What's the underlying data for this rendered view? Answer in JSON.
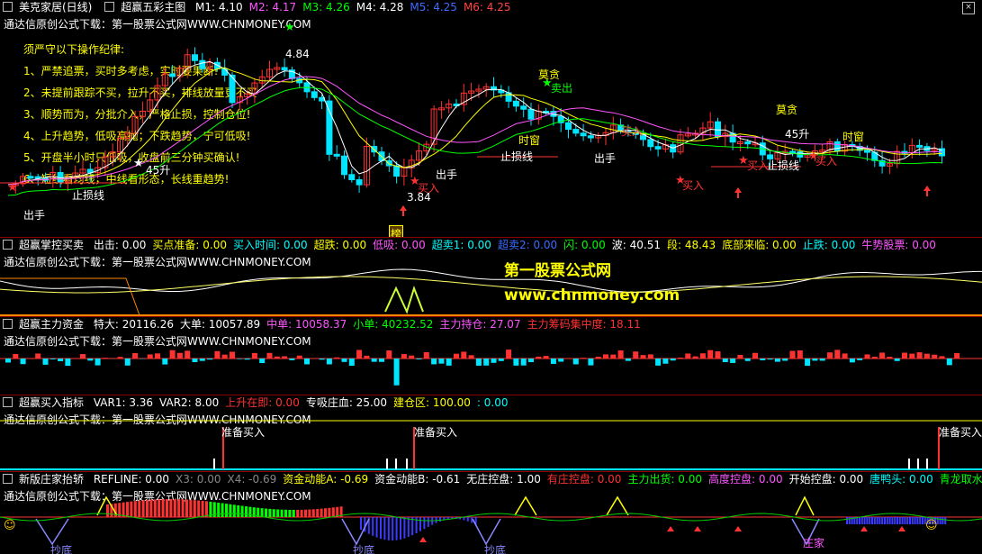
{
  "main": {
    "stock": "美克家居(日线)",
    "indicator": "超赢五彩主图",
    "ma": [
      {
        "label": "M1: 4.10",
        "color": "#ffffff"
      },
      {
        "label": "M2: 4.17",
        "color": "#ff55ff"
      },
      {
        "label": "M3: 4.26",
        "color": "#00ff00"
      },
      {
        "label": "M4: 4.28",
        "color": "#ffffff"
      },
      {
        "label": "M5: 4.25",
        "color": "#3b6bff"
      },
      {
        "label": "M6: 4.25",
        "color": "#ff4444"
      }
    ],
    "download": "通达信原创公式下载：第一股票公式网WWW.CHNMONEY.COM",
    "rules": [
      "须严守以下操作纪律:",
      "1、严禁追票，买时多考虑，实时要果断!",
      "2、未提前跟踪不买，拉升不买，排线放量更不买",
      "3、顺势而为，分批介入，严格止损，控制仓位!",
      "4、上升趋势，低吸高抛；下跌趋势，宁可低吸!",
      "5、开盘半小时只低吸，收盘前三分钟买确认!",
      "6、短线看均线，中线看形态，长线重趋势!"
    ],
    "labels": {
      "high_price": "4.84",
      "low_price": "3.84",
      "sell_out": "出手",
      "stop_loss": "止损线",
      "buy_in": "买入",
      "sell": "卖出",
      "greed": "莫贪",
      "timing": "时窗",
      "rise": "45升",
      "bang": "榜"
    },
    "colors": {
      "up": "#ff3232",
      "down": "#00e5ff",
      "grid": "#8b0000"
    }
  },
  "panel2": {
    "name": "超赢掌控买卖",
    "values": [
      {
        "label": "出击: 0.00",
        "color": "#ffffff"
      },
      {
        "label": "买点准备: 0.00",
        "color": "#ffff00"
      },
      {
        "label": "买入时间: 0.00",
        "color": "#00ffff"
      },
      {
        "label": "超跌: 0.00",
        "color": "#ffff00"
      },
      {
        "label": "低吸: 0.00",
        "color": "#ff55ff"
      },
      {
        "label": "超卖1: 0.00",
        "color": "#00ffff"
      },
      {
        "label": "超卖2: 0.00",
        "color": "#3b6bff"
      },
      {
        "label": "闪: 0.00",
        "color": "#00ff00"
      },
      {
        "label": "波: 40.51",
        "color": "#ffffff"
      },
      {
        "label": "段: 48.43",
        "color": "#ffff00"
      },
      {
        "label": "底部来临: 0.00",
        "color": "#ffff00"
      },
      {
        "label": "止跌: 0.00",
        "color": "#00ffff"
      },
      {
        "label": "牛势股票: 0.00",
        "color": "#ff55ff"
      }
    ],
    "download": "通达信原创公式下载：第一股票公式网WWW.CHNMONEY.COM",
    "watermark_title": "第一股票公式网",
    "watermark_url": "www.chnmoney.com"
  },
  "panel3": {
    "name": "超赢主力资金",
    "values": [
      {
        "label": "特大: 20116.26",
        "color": "#ffffff"
      },
      {
        "label": "大单: 10057.89",
        "color": "#ffffff"
      },
      {
        "label": "中单: 10058.37",
        "color": "#ff55ff"
      },
      {
        "label": "小单: 40232.52",
        "color": "#00ff00"
      },
      {
        "label": "主力持仓: 27.07",
        "color": "#ff55ff"
      },
      {
        "label": "主力筹码集中度: 18.11",
        "color": "#ff3232"
      }
    ],
    "download": "通达信原创公式下载：第一股票公式网WWW.CHNMONEY.COM"
  },
  "panel4": {
    "name": "超赢买入指标",
    "values": [
      {
        "label": "VAR1: 3.36",
        "color": "#ffffff"
      },
      {
        "label": "VAR2: 8.00",
        "color": "#ffffff"
      },
      {
        "label": "上升在即: 0.00",
        "color": "#ff3232"
      },
      {
        "label": "专吸庄血: 25.00",
        "color": "#ffffff"
      },
      {
        "label": "建仓区: 100.00",
        "color": "#ffff00"
      },
      {
        "label": ": 0.00",
        "color": "#00ffff"
      }
    ],
    "download": "通达信原创公式下载：第一股票公式网WWW.CHNMONEY.COM",
    "ready_buy": "准备买入"
  },
  "panel5": {
    "name": "新版庄家抬轿",
    "values": [
      {
        "label": "REFLINE: 0.00",
        "color": "#ffffff"
      },
      {
        "label": "X3: 0.00",
        "color": "#888888"
      },
      {
        "label": "X4: -0.69",
        "color": "#888888"
      },
      {
        "label": "资金动能A: -0.69",
        "color": "#ffff00"
      },
      {
        "label": "资金动能B: -0.61",
        "color": "#ffffff"
      },
      {
        "label": "无庄控盘: 1.00",
        "color": "#ffffff"
      },
      {
        "label": "有庄控盘: 0.00",
        "color": "#ff3232"
      },
      {
        "label": "主力出货: 0.00",
        "color": "#00ff00"
      },
      {
        "label": "高度控盘: 0.00",
        "color": "#ff55ff"
      },
      {
        "label": "开始控盘: 0.00",
        "color": "#ffffff"
      },
      {
        "label": "唐鸭头: 0.00",
        "color": "#00ffff"
      },
      {
        "label": "青龙取水: 0.00",
        "color": "#00ff00"
      },
      {
        "label": "绝",
        "color": "#ffffff"
      }
    ],
    "download": "通达信原创公式下载：第一股票公式网WWW.CHNMONEY.COM",
    "bottom_label": "抄底",
    "bottom_label2": "庄家"
  }
}
